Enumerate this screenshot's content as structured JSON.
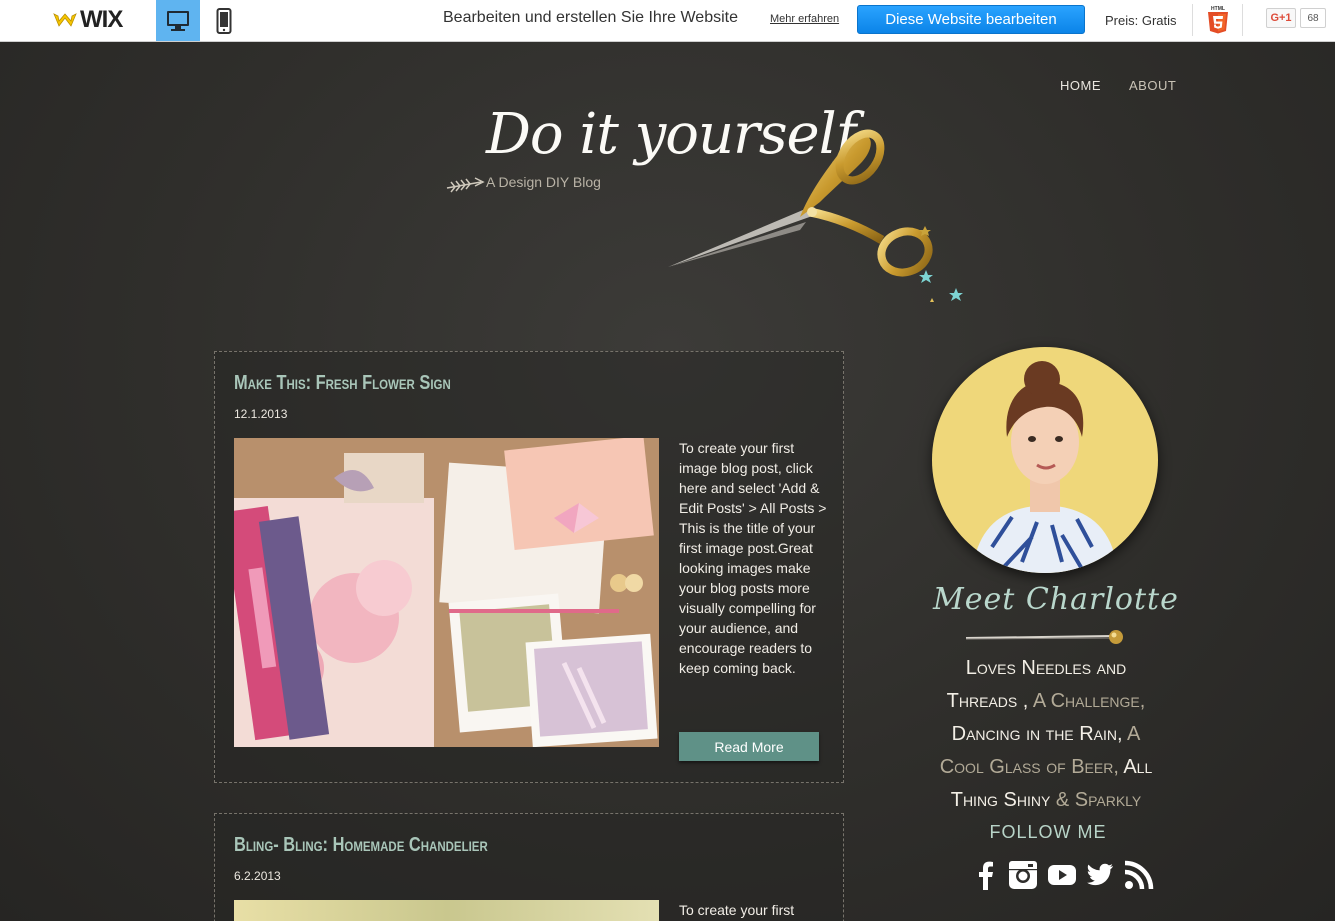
{
  "wixbar": {
    "logo_text": "WIX",
    "promo_text": "Bearbeiten und erstellen Sie Ihre Website",
    "more_link": "Mehr erfahren",
    "edit_button": "Diese Website bearbeiten",
    "price": "Preis: Gratis",
    "gplus_label": "G+1",
    "gplus_count": "68"
  },
  "nav": {
    "items": [
      "HOME",
      "ABOUT"
    ]
  },
  "brand": {
    "title": "Do it yourself",
    "subtitle": "A Design DIY Blog"
  },
  "posts": [
    {
      "title": "Make This: Fresh Flower Sign",
      "date": "12.1.2013",
      "excerpt": "To create your first image blog post, click here and select 'Add & Edit Posts' > All Posts > This is the title of your first image post.Great looking images make your blog posts more visually compelling for your audience, and encourage readers to keep coming back.",
      "read_more": "Read More"
    },
    {
      "title": "Bling- Bling: Homemade Chandelier",
      "date": "6.2.2013",
      "excerpt": "To create your first"
    }
  ],
  "sidebar": {
    "heading": "Meet Charlotte",
    "bio_parts": [
      {
        "text": "Loves Needles and Threads ,",
        "muted": false
      },
      {
        "text": "A Challenge,",
        "muted": true
      },
      {
        "text": "Dancing in the Rain,",
        "muted": false
      },
      {
        "text": "A Cool Glass of Beer,",
        "muted": true
      },
      {
        "text": "All Thing Shiny",
        "muted": false
      },
      {
        "text": "& Sparkly",
        "muted": true
      }
    ],
    "follow": "FOLLOW ME",
    "socials": [
      "facebook-icon",
      "instagram-icon",
      "youtube-icon",
      "twitter-icon",
      "rss-icon"
    ]
  },
  "colors": {
    "accent": "#5f9187",
    "mint": "#a9c6b9",
    "wix_blue": "#0b84e8",
    "background": "#2e2d2b"
  }
}
